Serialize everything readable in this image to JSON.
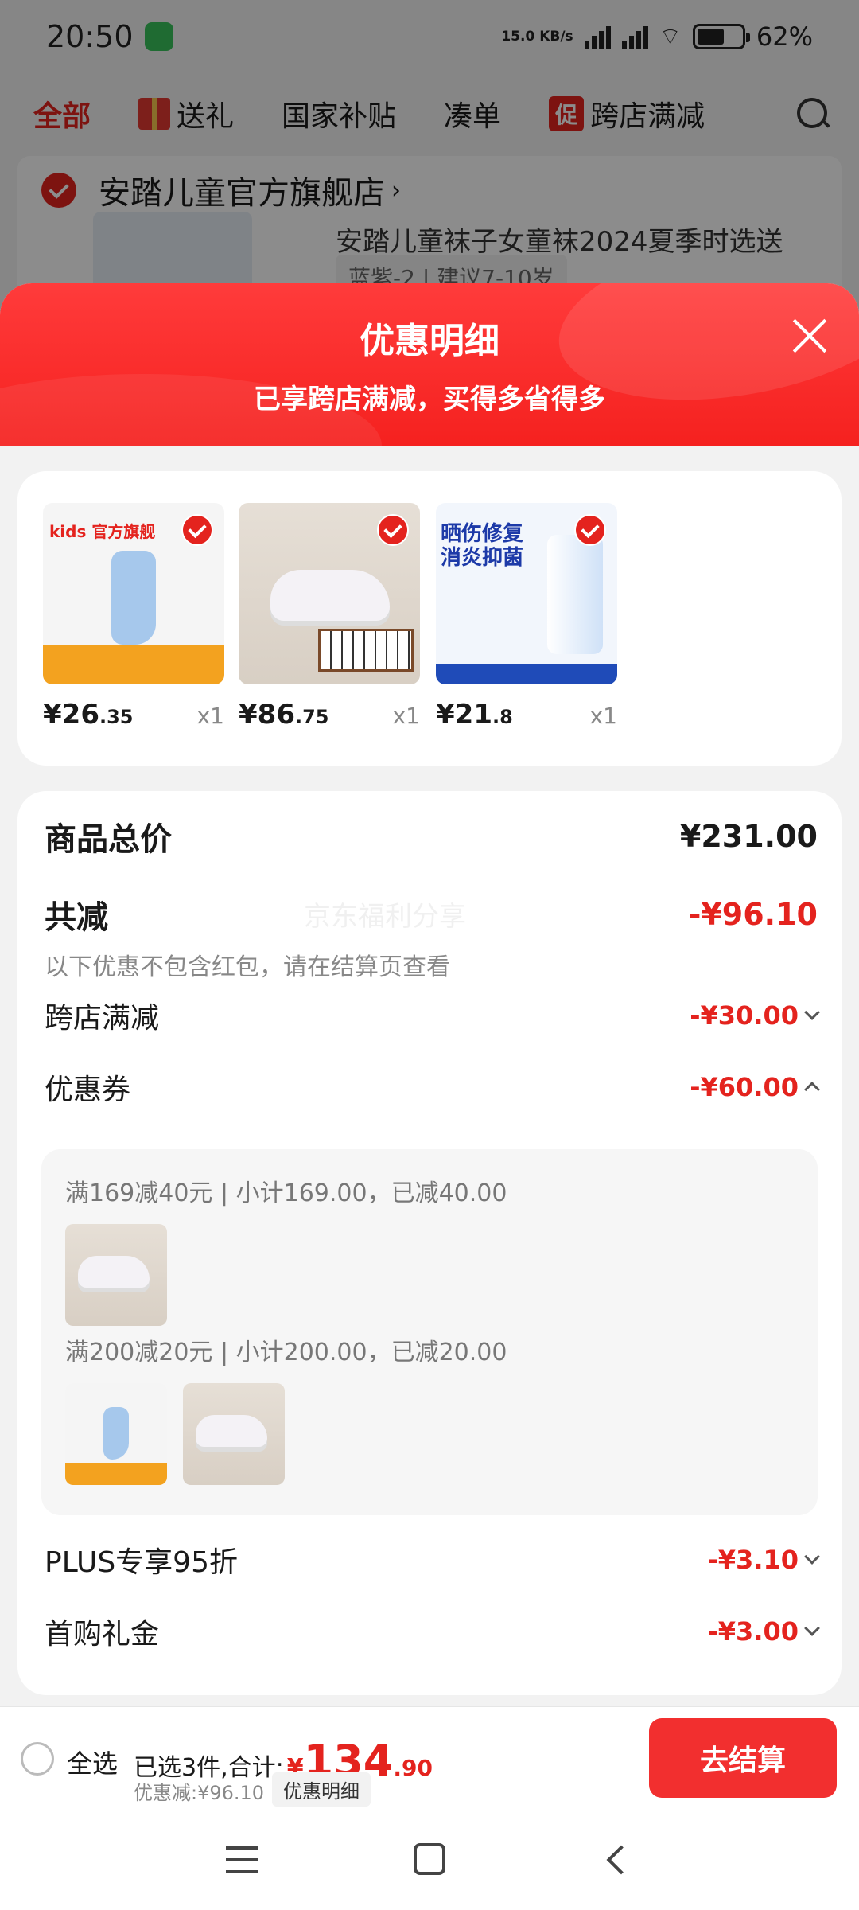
{
  "status_bar": {
    "time": "20:50",
    "net_speed": "15.0 KB/s",
    "battery": "62%",
    "battery_level": 0.62
  },
  "top_tabs": [
    {
      "label": "全部"
    },
    {
      "label": "送礼"
    },
    {
      "label": "国家补贴"
    },
    {
      "label": "凑单"
    },
    {
      "badge": "促",
      "label": "跨店满减"
    }
  ],
  "store": {
    "name": "安踏儿童官方旗舰店",
    "product_title": "安踏儿童袜子女童袜2024夏季时选送",
    "spec": "蓝紫-2  |  建议7-10岁"
  },
  "sheet": {
    "title": "优惠明细",
    "subtitle": "已享跨店满减，买得多省得多"
  },
  "products": [
    {
      "price_int": "¥26",
      "price_dec": ".35",
      "qty": "x1",
      "img_tag": "kids 官方旗舰"
    },
    {
      "price_int": "¥86",
      "price_dec": ".75",
      "qty": "x1"
    },
    {
      "price_int": "¥21",
      "price_dec": ".8",
      "qty": "x1",
      "img_headline": "晒伤修复\n消炎抑菌"
    }
  ],
  "summary": {
    "total_label": "商品总价",
    "total_value": "¥231.00",
    "reduce_label": "共减",
    "reduce_value": "-¥96.10",
    "note": "以下优惠不包含红包，请在结算页查看",
    "watermark": "京东福利分享",
    "cross_store_label": "跨店满减",
    "cross_store_value": "-¥30.00",
    "coupon_label": "优惠券",
    "coupon_value": "-¥60.00",
    "coupon_line_1": "满169减40元 | 小计169.00，已减40.00",
    "coupon_line_2": "满200减20元 | 小计200.00，已减20.00",
    "plus_label": "PLUS专享95折",
    "plus_value": "-¥3.10",
    "first_label": "首购礼金",
    "first_value": "-¥3.00"
  },
  "bottom": {
    "select_all": "全选",
    "selected_prefix": "已选3件,合计:",
    "currency": "¥",
    "amount_int": "134",
    "amount_dec": ".90",
    "discount": "优惠减:¥96.10",
    "detail_button": "优惠明细",
    "checkout": "去结算"
  },
  "colors": {
    "accent": "#e4231e",
    "header_gradient_top": "#ff3b3b",
    "checkout": "#f22f2f"
  }
}
